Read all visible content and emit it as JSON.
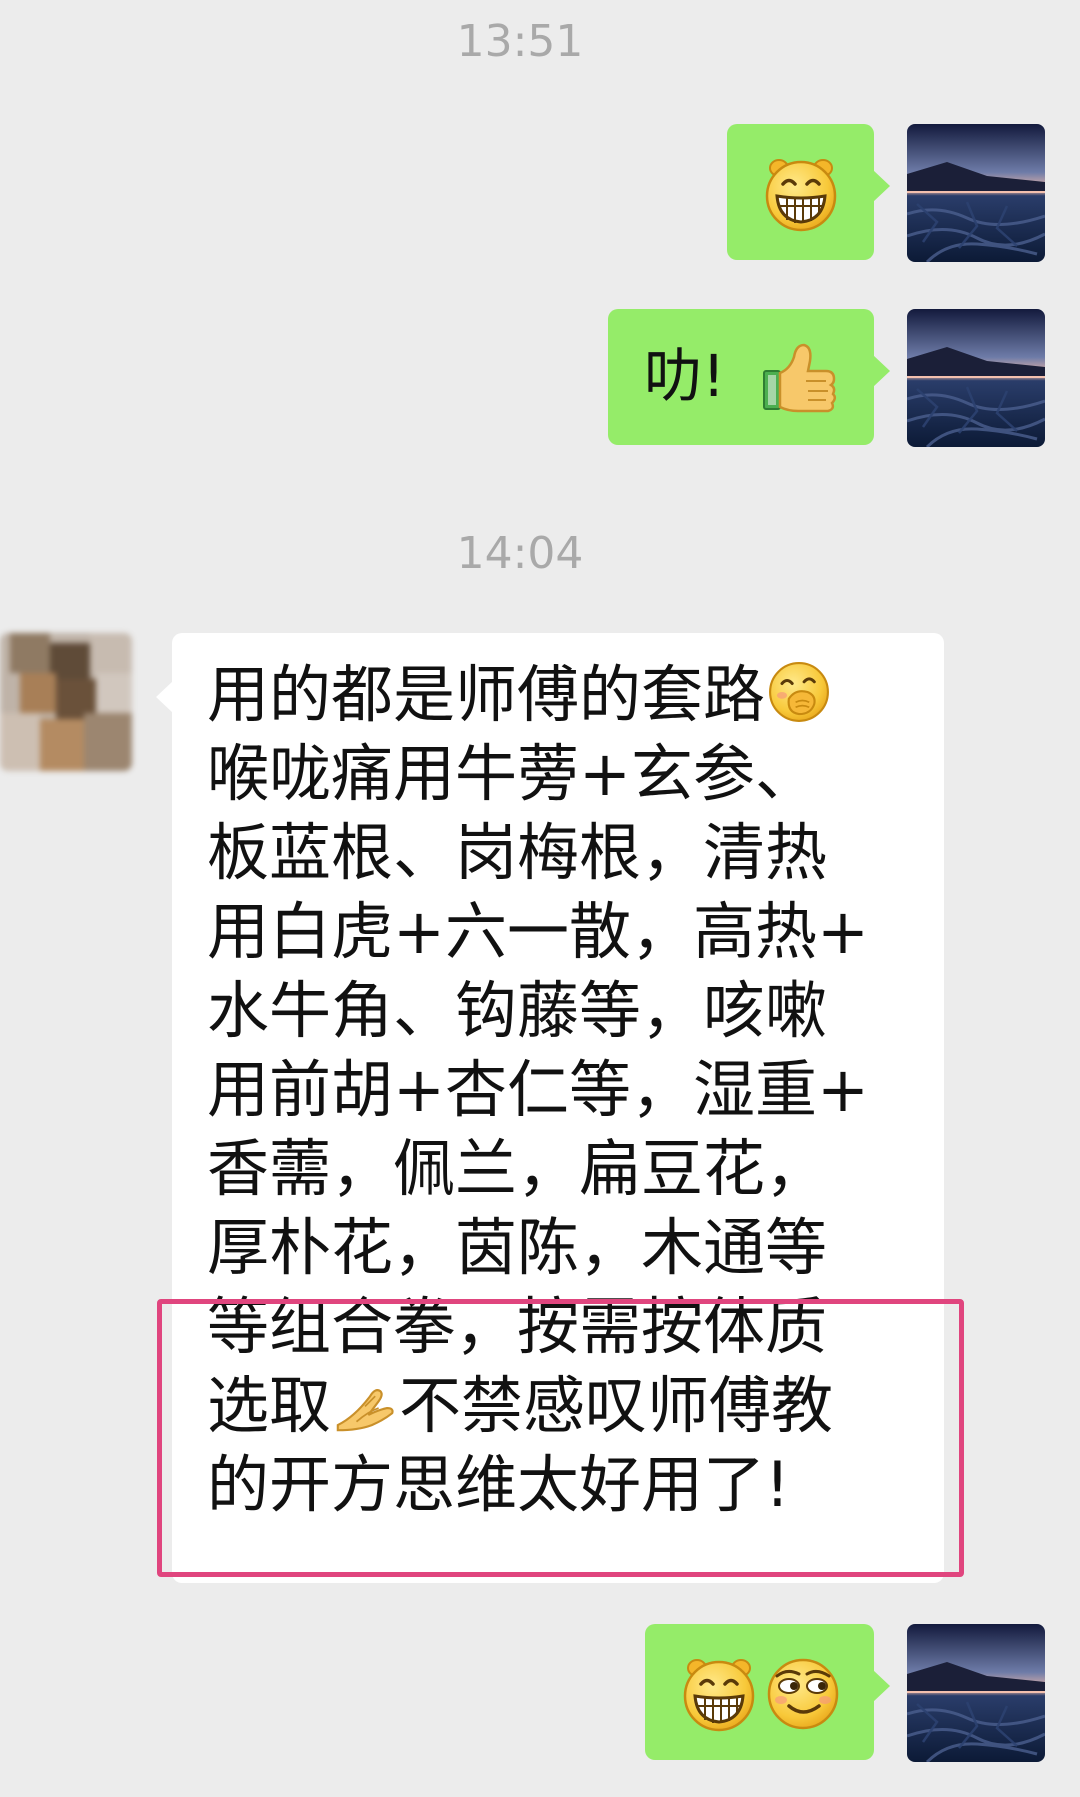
{
  "timestamps": [
    "13:51",
    "14:04"
  ],
  "messages": [
    {
      "sender": "me",
      "emoji": [
        "grin-icon"
      ]
    },
    {
      "sender": "me",
      "text": "叻!",
      "emoji": [
        "thumbs-up-icon"
      ]
    },
    {
      "sender": "them",
      "lines": [
        "用的都是师傅的套路",
        "喉咙痛用牛蒡+玄参、",
        "板蓝根、岗梅根，清热",
        "用白虎+六一散，高热+",
        "水牛角、钩藤等，咳嗽",
        "用前胡+杏仁等，湿重+",
        "香薷，佩兰，扁豆花，",
        "厚朴花，茵陈，木通等",
        "等组合拳，按需按体质",
        "选取",
        "不禁感叹师傅教",
        "的开方思维太好用了!"
      ],
      "emoji": [
        "cover-mouth-smile-icon",
        "pray-hands-icon"
      ]
    },
    {
      "sender": "me",
      "emoji": [
        "grin-icon",
        "smug-face-icon"
      ]
    }
  ],
  "colors": {
    "my_bubble": "#95ec69",
    "their_bubble": "#ffffff",
    "background": "#ececec",
    "highlight": "#e0457e"
  }
}
